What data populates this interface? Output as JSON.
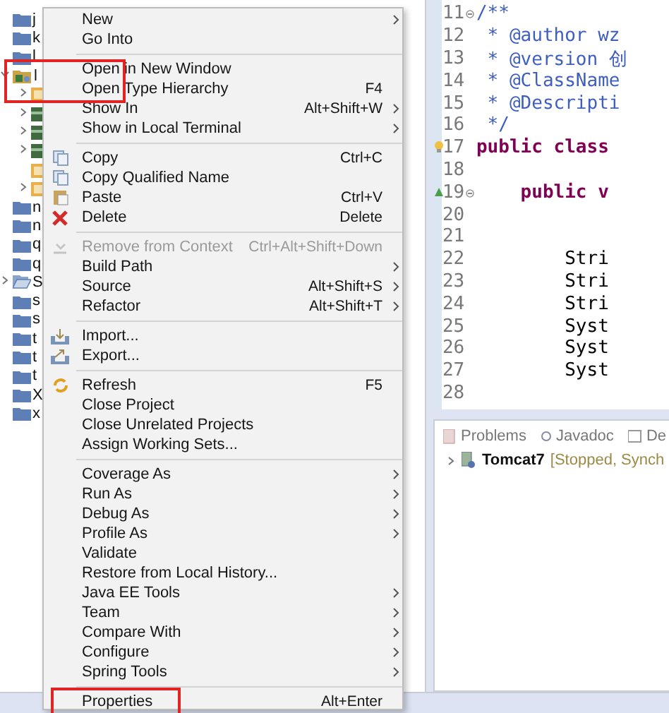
{
  "explorer": {
    "items": [
      {
        "label": "j",
        "kind": "folder",
        "highlighted": false
      },
      {
        "label": "k",
        "kind": "folder",
        "highlighted": false
      },
      {
        "label": "l",
        "kind": "folder",
        "highlighted": false
      },
      {
        "label": "l",
        "kind": "project",
        "expanded": true,
        "highlighted": true,
        "children": [
          {
            "kind": "package",
            "expanded": false,
            "highlighted": false
          },
          {
            "kind": "library",
            "expanded": false,
            "highlighted": false
          },
          {
            "kind": "library",
            "expanded": false,
            "highlighted": false
          },
          {
            "kind": "library",
            "expanded": false,
            "highlighted": false
          },
          {
            "kind": "package",
            "highlighted": false
          },
          {
            "kind": "package",
            "expanded": false,
            "highlighted": false
          }
        ]
      },
      {
        "label": "n",
        "kind": "folder",
        "highlighted": false
      },
      {
        "label": "n",
        "kind": "folder",
        "highlighted": false
      },
      {
        "label": "q",
        "kind": "folder",
        "highlighted": false
      },
      {
        "label": "q",
        "kind": "folder",
        "highlighted": false
      },
      {
        "label": "S",
        "kind": "open-folder",
        "expanded": false,
        "highlighted": false
      },
      {
        "label": "s",
        "kind": "folder",
        "highlighted": false
      },
      {
        "label": "s",
        "kind": "folder",
        "highlighted": false
      },
      {
        "label": "t",
        "kind": "folder",
        "highlighted": false
      },
      {
        "label": "t",
        "kind": "folder",
        "highlighted": false
      },
      {
        "label": "t",
        "kind": "folder",
        "highlighted": false
      },
      {
        "label": "X",
        "kind": "folder",
        "highlighted": false
      },
      {
        "label": "x",
        "kind": "folder",
        "highlighted": false
      }
    ]
  },
  "context_menu": [
    {
      "kind": "plain",
      "label": "New",
      "submenu": true,
      "disabled": false,
      "highlighted": false
    },
    {
      "kind": "plain",
      "label": "Go Into",
      "submenu": false,
      "disabled": false,
      "highlighted": false
    },
    {
      "kind": "separator"
    },
    {
      "kind": "plain",
      "label": "Open in New Window",
      "submenu": false,
      "disabled": false,
      "highlighted": false
    },
    {
      "kind": "plain",
      "label": "Open Type Hierarchy",
      "shortcut": "F4",
      "submenu": false,
      "disabled": false,
      "highlighted": false
    },
    {
      "kind": "plain",
      "label": "Show In",
      "shortcut": "Alt+Shift+W",
      "submenu": true,
      "disabled": false,
      "highlighted": false
    },
    {
      "kind": "plain",
      "label": "Show in Local Terminal",
      "submenu": true,
      "disabled": false,
      "highlighted": false
    },
    {
      "kind": "separator"
    },
    {
      "kind": "copy",
      "label": "Copy",
      "shortcut": "Ctrl+C",
      "submenu": false,
      "disabled": false,
      "highlighted": false
    },
    {
      "kind": "copy",
      "label": "Copy Qualified Name",
      "submenu": false,
      "disabled": false,
      "highlighted": false
    },
    {
      "kind": "paste",
      "label": "Paste",
      "shortcut": "Ctrl+V",
      "submenu": false,
      "disabled": false,
      "highlighted": false
    },
    {
      "kind": "delete",
      "label": "Delete",
      "shortcut": "Delete",
      "submenu": false,
      "disabled": false,
      "highlighted": false
    },
    {
      "kind": "separator"
    },
    {
      "kind": "remove",
      "label": "Remove from Context",
      "shortcut": "Ctrl+Alt+Shift+Down",
      "submenu": false,
      "disabled": true,
      "highlighted": false
    },
    {
      "kind": "plain",
      "label": "Build Path",
      "submenu": true,
      "disabled": false,
      "highlighted": false
    },
    {
      "kind": "plain",
      "label": "Source",
      "shortcut": "Alt+Shift+S",
      "submenu": true,
      "disabled": false,
      "highlighted": false
    },
    {
      "kind": "plain",
      "label": "Refactor",
      "shortcut": "Alt+Shift+T",
      "submenu": true,
      "disabled": false,
      "highlighted": false
    },
    {
      "kind": "separator"
    },
    {
      "kind": "import",
      "label": "Import...",
      "submenu": false,
      "disabled": false,
      "highlighted": false
    },
    {
      "kind": "export",
      "label": "Export...",
      "submenu": false,
      "disabled": false,
      "highlighted": false
    },
    {
      "kind": "separator"
    },
    {
      "kind": "refresh",
      "label": "Refresh",
      "shortcut": "F5",
      "submenu": false,
      "disabled": false,
      "highlighted": false
    },
    {
      "kind": "plain",
      "label": "Close Project",
      "submenu": false,
      "disabled": false,
      "highlighted": false
    },
    {
      "kind": "plain",
      "label": "Close Unrelated Projects",
      "submenu": false,
      "disabled": false,
      "highlighted": false
    },
    {
      "kind": "plain",
      "label": "Assign Working Sets...",
      "submenu": false,
      "disabled": false,
      "highlighted": false
    },
    {
      "kind": "separator"
    },
    {
      "kind": "plain",
      "label": "Coverage As",
      "submenu": true,
      "disabled": false,
      "highlighted": false
    },
    {
      "kind": "plain",
      "label": "Run As",
      "submenu": true,
      "disabled": false,
      "highlighted": false
    },
    {
      "kind": "plain",
      "label": "Debug As",
      "submenu": true,
      "disabled": false,
      "highlighted": false
    },
    {
      "kind": "plain",
      "label": "Profile As",
      "submenu": true,
      "disabled": false,
      "highlighted": false
    },
    {
      "kind": "plain",
      "label": "Validate",
      "submenu": false,
      "disabled": false,
      "highlighted": false
    },
    {
      "kind": "plain",
      "label": "Restore from Local History...",
      "submenu": false,
      "disabled": false,
      "highlighted": false
    },
    {
      "kind": "plain",
      "label": "Java EE Tools",
      "submenu": true,
      "disabled": false,
      "highlighted": false
    },
    {
      "kind": "plain",
      "label": "Team",
      "submenu": true,
      "disabled": false,
      "highlighted": false
    },
    {
      "kind": "plain",
      "label": "Compare With",
      "submenu": true,
      "disabled": false,
      "highlighted": false
    },
    {
      "kind": "plain",
      "label": "Configure",
      "submenu": true,
      "disabled": false,
      "highlighted": false
    },
    {
      "kind": "plain",
      "label": "Spring Tools",
      "submenu": true,
      "disabled": false,
      "highlighted": false
    },
    {
      "kind": "separator"
    },
    {
      "kind": "plain",
      "label": "Properties",
      "shortcut": "Alt+Enter",
      "submenu": false,
      "disabled": false,
      "highlighted": true
    }
  ],
  "editor": {
    "lines": [
      {
        "number": "11",
        "text": "/**",
        "kind": "comment",
        "fold": true,
        "warning": false,
        "override": false
      },
      {
        "number": "12",
        "text": " * @author wz",
        "kind": "comment",
        "fold": false,
        "warning": false,
        "override": false
      },
      {
        "number": "13",
        "text": " * @version 创",
        "kind": "comment",
        "fold": false,
        "warning": false,
        "override": false
      },
      {
        "number": "14",
        "text": " * @ClassName",
        "kind": "comment",
        "fold": false,
        "warning": false,
        "override": false
      },
      {
        "number": "15",
        "text": " * @Descripti",
        "kind": "comment",
        "fold": false,
        "warning": false,
        "override": false
      },
      {
        "number": "16",
        "text": " */",
        "kind": "comment",
        "fold": false,
        "warning": false,
        "override": false
      },
      {
        "number": "17",
        "text": "public class",
        "kind": "keyword",
        "fold": false,
        "warning": true,
        "override": false
      },
      {
        "number": "18",
        "fold": false,
        "warning": false,
        "override": false
      },
      {
        "number": "19",
        "text": "    public v",
        "kind": "keyword",
        "fold": true,
        "warning": false,
        "override": true
      },
      {
        "number": "20",
        "fold": false,
        "warning": false,
        "override": false
      },
      {
        "number": "21",
        "fold": false,
        "warning": false,
        "override": false
      },
      {
        "number": "22",
        "text": "        Stri",
        "kind": "code",
        "fold": false,
        "warning": false,
        "override": false
      },
      {
        "number": "23",
        "text": "        Stri",
        "kind": "code",
        "fold": false,
        "warning": false,
        "override": false
      },
      {
        "number": "24",
        "text": "        Stri",
        "kind": "code",
        "fold": false,
        "warning": false,
        "override": false
      },
      {
        "number": "25",
        "text": "        Syst",
        "kind": "code",
        "fold": false,
        "warning": false,
        "override": false
      },
      {
        "number": "26",
        "text": "        Syst",
        "kind": "code",
        "fold": false,
        "warning": false,
        "override": false
      },
      {
        "number": "27",
        "text": "        Syst",
        "kind": "code",
        "fold": false,
        "warning": false,
        "override": false
      },
      {
        "number": "28",
        "fold": false,
        "warning": false,
        "override": false
      }
    ]
  },
  "bottom_panel": {
    "tabs": [
      {
        "label": "Problems",
        "kind": "problems",
        "selected": false
      },
      {
        "label": "Javadoc",
        "kind": "javadoc",
        "selected": false
      },
      {
        "label": "De",
        "kind": "declaration",
        "selected": false
      }
    ],
    "servers": [
      {
        "name": "Tomcat7",
        "status": "[Stopped, Synch"
      }
    ]
  }
}
